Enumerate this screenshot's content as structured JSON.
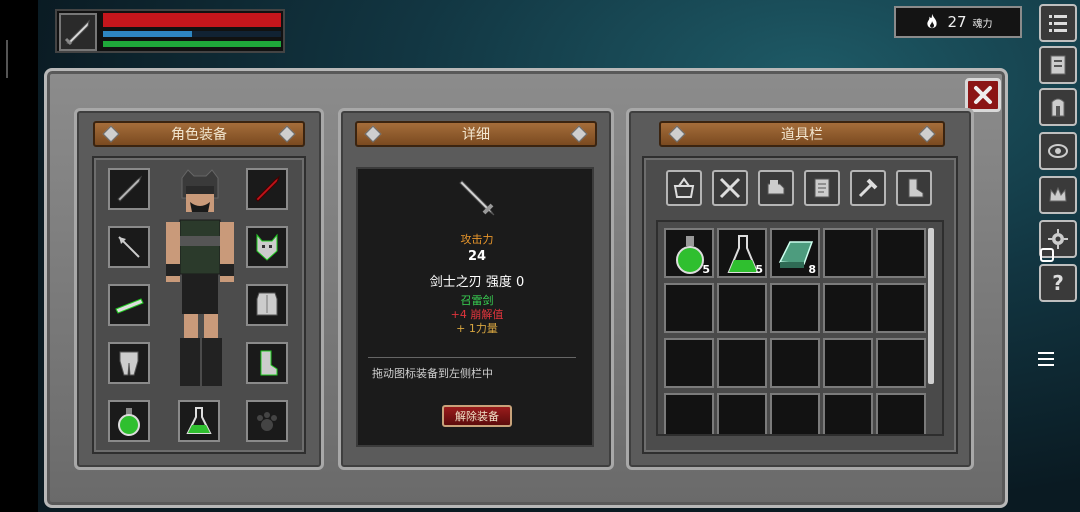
{
  "hud": {
    "health_fraction": 1.0,
    "mana_fraction": 0.5,
    "stamina_fraction": 1.0,
    "weapon_icon": "sword-icon"
  },
  "currency": {
    "amount": "27",
    "unit": "魂力",
    "icon": "flame-icon"
  },
  "sidebar": {
    "items": [
      {
        "name": "menu-list-icon"
      },
      {
        "name": "journal-icon"
      },
      {
        "name": "door-icon"
      },
      {
        "name": "eye-target-icon"
      },
      {
        "name": "crown-icon"
      },
      {
        "name": "gear-icon"
      },
      {
        "name": "help-icon",
        "label": "?"
      }
    ]
  },
  "panels": {
    "equipment": {
      "title": "角色装备"
    },
    "details": {
      "title": "详细"
    },
    "inventory": {
      "title": "道具栏"
    }
  },
  "details": {
    "stat_label": "攻击力",
    "stat_value": "24",
    "item_name": "剑士之刃 强度 0",
    "enchant": "召雷剑",
    "bonus1": "+4 崩解值",
    "bonus2": "+ 1力量",
    "hint": "拖动图标装备到左侧栏中",
    "unequip_label": "解除装备"
  },
  "inventory": {
    "items": [
      {
        "icon": "green-potion-round-icon",
        "qty": "5"
      },
      {
        "icon": "green-potion-flask-icon",
        "qty": "5"
      },
      {
        "icon": "metal-ingot-icon",
        "qty": "8"
      }
    ]
  },
  "colors": {
    "plank": "#8a5a2b",
    "hp": "#c4161c",
    "mp": "#2e86c1",
    "stamina": "#1fa83a",
    "stat_label": "#e8962b",
    "enchant": "#39d353",
    "bonus_red": "#e0343c",
    "bonus_gold": "#d8a640"
  }
}
